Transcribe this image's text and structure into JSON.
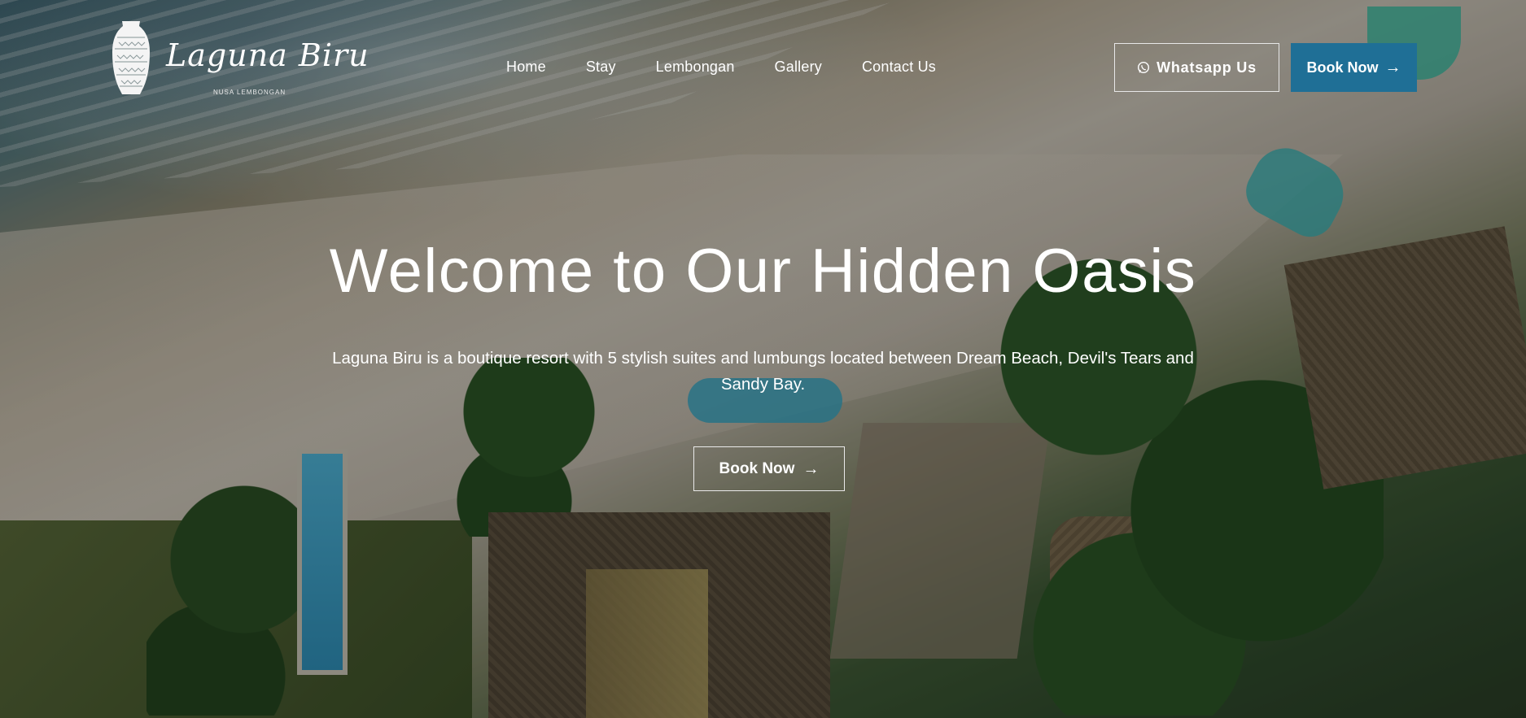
{
  "brand": {
    "name": "Laguna Biru",
    "tagline": "NUSA LEMBONGAN"
  },
  "nav": {
    "items": [
      {
        "label": "Home"
      },
      {
        "label": "Stay"
      },
      {
        "label": "Lembongan"
      },
      {
        "label": "Gallery"
      },
      {
        "label": "Contact Us"
      }
    ]
  },
  "header": {
    "whatsapp_label": "Whatsapp Us",
    "book_label": "Book Now",
    "book_color": "#1f6f96"
  },
  "hero": {
    "title": "Welcome to Our Hidden Oasis",
    "description": "Laguna Biru is a boutique resort with 5 stylish suites and lumbungs located between Dream Beach, Devil's Tears and Sandy Bay.",
    "cta_label": "Book Now"
  },
  "icons": {
    "whatsapp": "whatsapp-icon",
    "arrow": "arrow-right-icon",
    "logo": "vase-logo-icon"
  }
}
